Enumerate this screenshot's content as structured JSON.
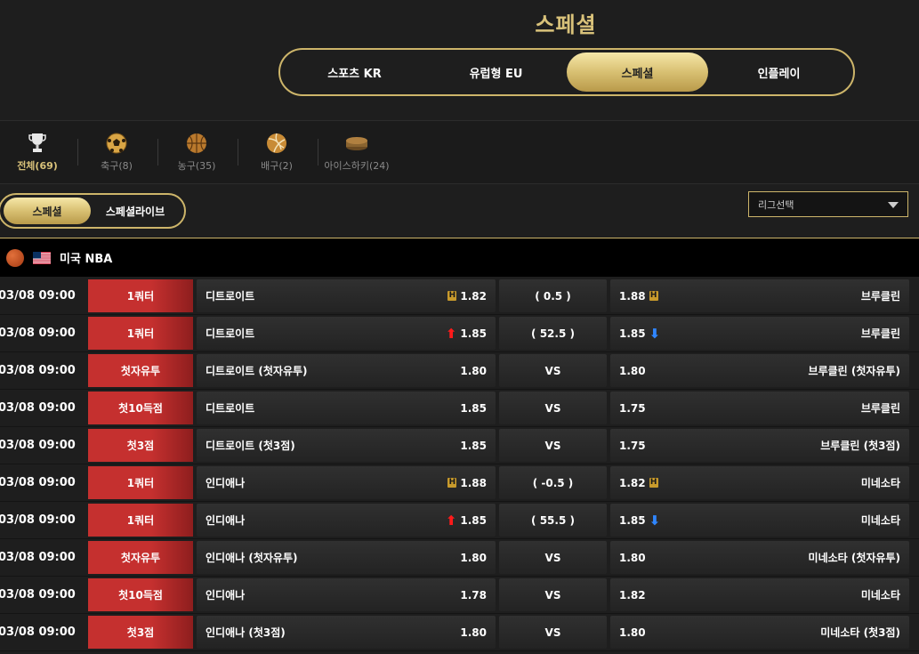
{
  "page_title": "스페셜",
  "market_tabs": [
    {
      "label": "스포츠 KR",
      "active": false
    },
    {
      "label": "유럽형 EU",
      "active": false
    },
    {
      "label": "스페셜",
      "active": true
    },
    {
      "label": "인플레이",
      "active": false
    }
  ],
  "sports": [
    {
      "label": "전체(69)",
      "icon": "trophy-icon",
      "active": true
    },
    {
      "label": "축구(8)",
      "icon": "soccer-ball-icon",
      "active": false
    },
    {
      "label": "농구(35)",
      "icon": "basketball-icon",
      "active": false
    },
    {
      "label": "배구(2)",
      "icon": "volleyball-icon",
      "active": false
    },
    {
      "label": "아이스하키(24)",
      "icon": "hockey-puck-icon",
      "active": false
    }
  ],
  "sub_tabs": [
    {
      "label": "스페셜",
      "active": true
    },
    {
      "label": "스페셜라이브",
      "active": false
    }
  ],
  "league_select": {
    "label": "리그선택"
  },
  "league": {
    "name": "미국 NBA",
    "icon": "basketball-icon",
    "flag": "us-flag-icon"
  },
  "colors": {
    "gold": "#cdb56a",
    "red": "#c5302f",
    "up": "#ff1a1a",
    "down": "#2f86ff"
  },
  "rows": [
    {
      "time": "03/08 09:00",
      "type": "1쿼터",
      "home": "디트로이트",
      "home_odds": "1.82",
      "home_mark": "H",
      "mid": "( 0.5 )",
      "away_odds": "1.88",
      "away_mark": "H",
      "away": "브루클린"
    },
    {
      "time": "03/08 09:00",
      "type": "1쿼터",
      "home": "디트로이트",
      "home_odds": "1.85",
      "home_mark": "up",
      "mid": "( 52.5 )",
      "away_odds": "1.85",
      "away_mark": "down",
      "away": "브루클린"
    },
    {
      "time": "03/08 09:00",
      "type": "첫자유투",
      "home": "디트로이트 (첫자유투)",
      "home_odds": "1.80",
      "home_mark": "",
      "mid": "VS",
      "away_odds": "1.80",
      "away_mark": "",
      "away": "브루클린 (첫자유투)"
    },
    {
      "time": "03/08 09:00",
      "type": "첫10득점",
      "home": "디트로이트",
      "home_odds": "1.85",
      "home_mark": "",
      "mid": "VS",
      "away_odds": "1.75",
      "away_mark": "",
      "away": "브루클린"
    },
    {
      "time": "03/08 09:00",
      "type": "첫3점",
      "home": "디트로이트 (첫3점)",
      "home_odds": "1.85",
      "home_mark": "",
      "mid": "VS",
      "away_odds": "1.75",
      "away_mark": "",
      "away": "브루클린 (첫3점)"
    },
    {
      "time": "03/08 09:00",
      "type": "1쿼터",
      "home": "인디애나",
      "home_odds": "1.88",
      "home_mark": "H",
      "mid": "( -0.5 )",
      "away_odds": "1.82",
      "away_mark": "H",
      "away": "미네소타"
    },
    {
      "time": "03/08 09:00",
      "type": "1쿼터",
      "home": "인디애나",
      "home_odds": "1.85",
      "home_mark": "up",
      "mid": "( 55.5 )",
      "away_odds": "1.85",
      "away_mark": "down",
      "away": "미네소타"
    },
    {
      "time": "03/08 09:00",
      "type": "첫자유투",
      "home": "인디애나 (첫자유투)",
      "home_odds": "1.80",
      "home_mark": "",
      "mid": "VS",
      "away_odds": "1.80",
      "away_mark": "",
      "away": "미네소타 (첫자유투)"
    },
    {
      "time": "03/08 09:00",
      "type": "첫10득점",
      "home": "인디애나",
      "home_odds": "1.78",
      "home_mark": "",
      "mid": "VS",
      "away_odds": "1.82",
      "away_mark": "",
      "away": "미네소타"
    },
    {
      "time": "03/08 09:00",
      "type": "첫3점",
      "home": "인디애나 (첫3점)",
      "home_odds": "1.80",
      "home_mark": "",
      "mid": "VS",
      "away_odds": "1.80",
      "away_mark": "",
      "away": "미네소타 (첫3점)"
    }
  ]
}
